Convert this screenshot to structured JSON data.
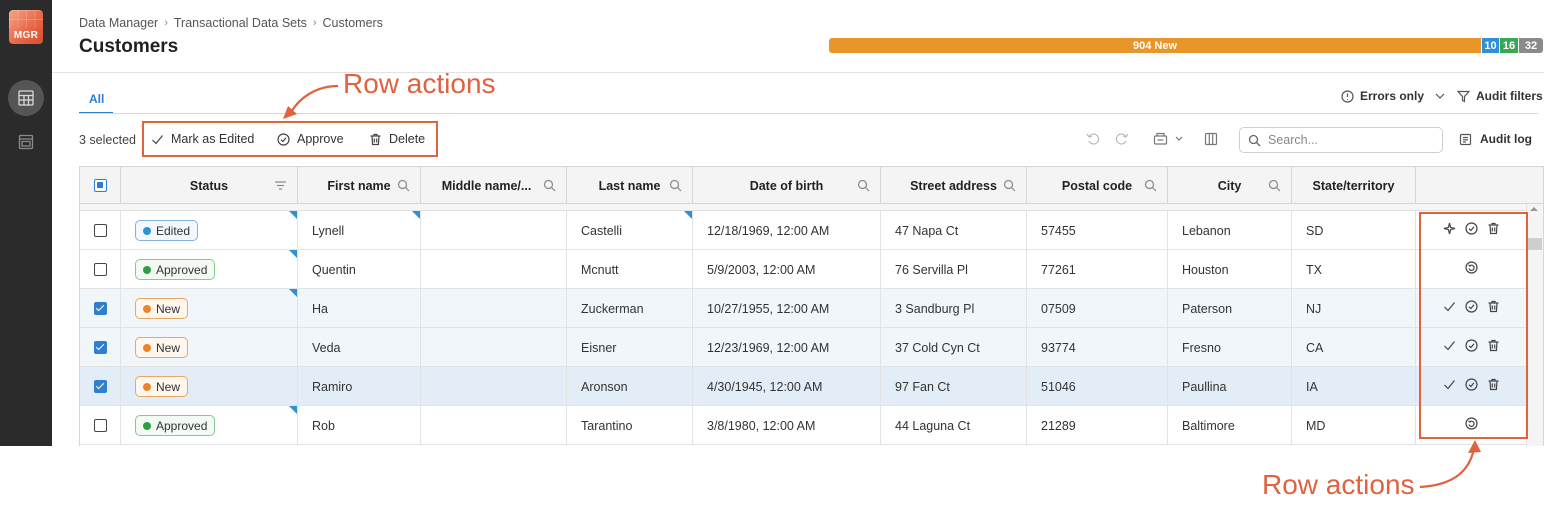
{
  "app": {
    "logo_text": "MGR"
  },
  "sidebar": {
    "items": [
      {
        "icon": "table-grid-icon",
        "active": true
      },
      {
        "icon": "document-list-icon",
        "active": false
      }
    ]
  },
  "breadcrumb": {
    "items": [
      "Data Manager",
      "Transactional Data Sets",
      "Customers"
    ]
  },
  "page": {
    "title": "Customers"
  },
  "progress": {
    "new_label": "904 New",
    "blue_count": "10",
    "green_count": "16",
    "gray_count": "32",
    "colors": {
      "new": "#e8952a",
      "edited": "#2f8fd8",
      "approved": "#38a853",
      "other": "#8a8a8a"
    }
  },
  "tabs": [
    {
      "label": "All",
      "active": true
    }
  ],
  "filters": {
    "errors_only": "Errors only",
    "audit_filters": "Audit filters"
  },
  "toolbar": {
    "selected_count": "3 selected",
    "mark_as_edited": "Mark as Edited",
    "approve": "Approve",
    "delete": "Delete",
    "search_placeholder": "Search...",
    "audit_log": "Audit log"
  },
  "table": {
    "columns": [
      "Status",
      "First name",
      "Middle name/...",
      "Last name",
      "Date of birth",
      "Street address",
      "Postal code",
      "City",
      "State/territory"
    ],
    "rows": [
      {
        "checked": false,
        "status": "Edited",
        "first": "Lynell",
        "middle": "",
        "last": "Castelli",
        "dob": "12/18/1969, 12:00 AM",
        "street": "47 Napa Ct",
        "postal": "57455",
        "city": "Lebanon",
        "state": "SD",
        "actions": [
          "mark-edited-icon",
          "approve-icon",
          "delete-icon"
        ]
      },
      {
        "checked": false,
        "status": "Approved",
        "first": "Quentin",
        "middle": "",
        "last": "Mcnutt",
        "dob": "5/9/2003, 12:00 AM",
        "street": "76 Servilla Pl",
        "postal": "77261",
        "city": "Houston",
        "state": "TX",
        "actions": [
          "revert-icon"
        ]
      },
      {
        "checked": true,
        "status": "New",
        "first": "Ha",
        "middle": "",
        "last": "Zuckerman",
        "dob": "10/27/1955, 12:00 AM",
        "street": "3 Sandburg Pl",
        "postal": "07509",
        "city": "Paterson",
        "state": "NJ",
        "actions": [
          "checkmark-icon",
          "approve-icon",
          "delete-icon"
        ]
      },
      {
        "checked": true,
        "status": "New",
        "first": "Veda",
        "middle": "",
        "last": "Eisner",
        "dob": "12/23/1969, 12:00 AM",
        "street": "37 Cold Cyn Ct",
        "postal": "93774",
        "city": "Fresno",
        "state": "CA",
        "actions": [
          "checkmark-icon",
          "approve-icon",
          "delete-icon"
        ]
      },
      {
        "checked": true,
        "status": "New",
        "first": "Ramiro",
        "middle": "",
        "last": "Aronson",
        "dob": "4/30/1945, 12:00 AM",
        "street": "97 Fan Ct",
        "postal": "51046",
        "city": "Paullina",
        "state": "IA",
        "actions": [
          "checkmark-icon",
          "approve-icon",
          "delete-icon"
        ]
      },
      {
        "checked": false,
        "status": "Approved",
        "first": "Rob",
        "middle": "",
        "last": "Tarantino",
        "dob": "3/8/1980, 12:00 AM",
        "street": "44 Laguna Ct",
        "postal": "21289",
        "city": "Baltimore",
        "state": "MD",
        "actions": [
          "revert-icon"
        ]
      }
    ]
  },
  "annotations": {
    "top_label": "Row actions",
    "bottom_label": "Row actions",
    "color": "#e0623f"
  }
}
